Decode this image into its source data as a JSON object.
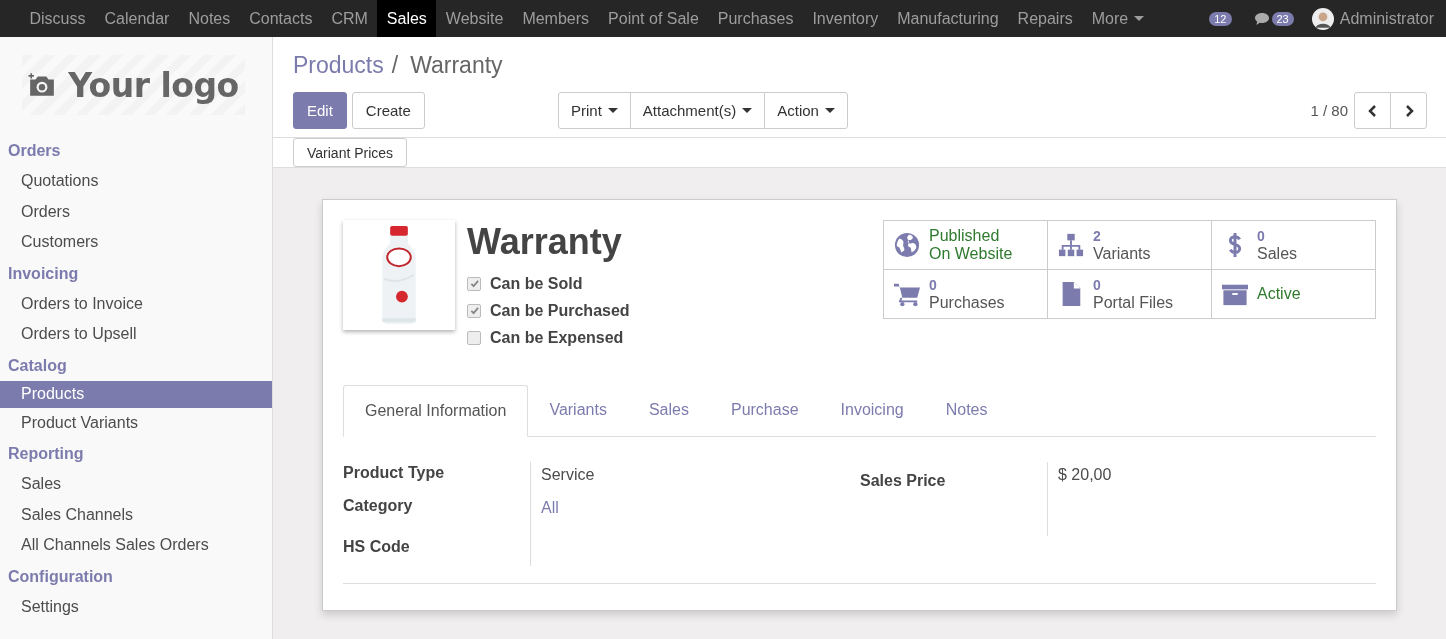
{
  "top_menu": [
    {
      "label": "Discuss",
      "selected": false
    },
    {
      "label": "Calendar",
      "selected": false
    },
    {
      "label": "Notes",
      "selected": false
    },
    {
      "label": "Contacts",
      "selected": false
    },
    {
      "label": "CRM",
      "selected": false
    },
    {
      "label": "Sales",
      "selected": true
    },
    {
      "label": "Website",
      "selected": false
    },
    {
      "label": "Members",
      "selected": false
    },
    {
      "label": "Point of Sale",
      "selected": false
    },
    {
      "label": "Purchases",
      "selected": false
    },
    {
      "label": "Inventory",
      "selected": false
    },
    {
      "label": "Manufacturing",
      "selected": false
    },
    {
      "label": "Repairs",
      "selected": false
    },
    {
      "label": "More",
      "selected": false
    }
  ],
  "systray": {
    "activity_count": "12",
    "message_count": "23",
    "user": "Administrator"
  },
  "logo": {
    "text": "Your logo"
  },
  "sidebar": [
    {
      "heading": "Orders",
      "items": [
        {
          "label": "Quotations",
          "selected": false
        },
        {
          "label": "Orders",
          "selected": false
        },
        {
          "label": "Customers",
          "selected": false
        }
      ]
    },
    {
      "heading": "Invoicing",
      "items": [
        {
          "label": "Orders to Invoice",
          "selected": false
        },
        {
          "label": "Orders to Upsell",
          "selected": false
        }
      ]
    },
    {
      "heading": "Catalog",
      "items": [
        {
          "label": "Products",
          "selected": true
        },
        {
          "label": "Product Variants",
          "selected": false
        }
      ]
    },
    {
      "heading": "Reporting",
      "items": [
        {
          "label": "Sales",
          "selected": false
        },
        {
          "label": "Sales Channels",
          "selected": false
        },
        {
          "label": "All Channels Sales Orders",
          "selected": false
        }
      ]
    },
    {
      "heading": "Configuration",
      "items": [
        {
          "label": "Settings",
          "selected": false
        }
      ]
    }
  ],
  "breadcrumbs": [
    "Products",
    "Warranty"
  ],
  "breadcrumb_separator": "/",
  "buttons": [
    "Edit",
    "Create"
  ],
  "dropdowns": [
    "Print",
    "Attachment(s)",
    "Action"
  ],
  "pager": "1 / 80",
  "action_buttons": [
    "Variant Prices"
  ],
  "product": {
    "name": "Warranty",
    "options": [
      {
        "label": "Can be Sold",
        "checked": true
      },
      {
        "label": "Can be Purchased",
        "checked": true
      },
      {
        "label": "Can be Expensed",
        "checked": false
      }
    ],
    "smart_buttons": [
      {
        "kind": "globe",
        "lines": [
          "Published",
          "On Website"
        ],
        "color": "#2f7a2f"
      },
      {
        "kind": "sitemap",
        "count": "2",
        "label": "Variants"
      },
      {
        "kind": "dollar",
        "count": "0",
        "label": "Sales"
      },
      {
        "kind": "cart",
        "count": "0",
        "label": "Purchases"
      },
      {
        "kind": "file",
        "count": "0",
        "label": "Portal Files"
      },
      {
        "kind": "archive",
        "label": "Active",
        "color": "#2f7a2f"
      }
    ],
    "tabs": [
      {
        "label": "General Information",
        "selected": true
      },
      {
        "label": "Variants",
        "selected": false
      },
      {
        "label": "Sales",
        "selected": false
      },
      {
        "label": "Purchase",
        "selected": false
      },
      {
        "label": "Invoicing",
        "selected": false
      },
      {
        "label": "Notes",
        "selected": false
      }
    ],
    "fields_left": [
      {
        "label": "Product Type",
        "value": "Service",
        "link": false
      },
      {
        "label": "Category",
        "value": "All",
        "link": true
      },
      {
        "label": "HS Code"
      }
    ],
    "fields_right": [
      {
        "label": "Sales Price",
        "value": "$ 20,00",
        "link": false
      }
    ]
  }
}
